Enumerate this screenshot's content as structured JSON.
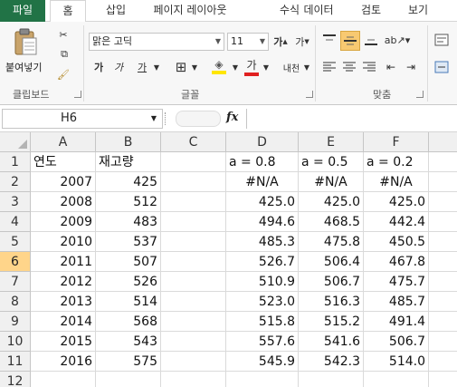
{
  "menu": {
    "tabs": [
      "파일",
      "홈",
      "삽입",
      "페이지 레이아웃",
      "수식",
      "데이터",
      "검토",
      "보기"
    ]
  },
  "ribbon": {
    "paste_label": "붙여넣기",
    "font_name": "맑은 고딕",
    "font_size": "11",
    "groups": {
      "clipboard": "클립보드",
      "font": "글꼴",
      "align": "맞춤"
    }
  },
  "formula_bar": {
    "name_box": "H6",
    "fx": "fx",
    "formula": ""
  },
  "sheet": {
    "columns": [
      "A",
      "B",
      "C",
      "D",
      "E",
      "F"
    ],
    "rows": [
      {
        "n": "1",
        "a": "연도",
        "b": "재고량",
        "c": "",
        "d": "a = 0.8",
        "e": "a = 0.5",
        "f": "a = 0.2"
      },
      {
        "n": "2",
        "a": "2007",
        "b": "425",
        "c": "",
        "d": "#N/A",
        "e": "#N/A",
        "f": "#N/A"
      },
      {
        "n": "3",
        "a": "2008",
        "b": "512",
        "c": "",
        "d": "425.0",
        "e": "425.0",
        "f": "425.0"
      },
      {
        "n": "4",
        "a": "2009",
        "b": "483",
        "c": "",
        "d": "494.6",
        "e": "468.5",
        "f": "442.4"
      },
      {
        "n": "5",
        "a": "2010",
        "b": "537",
        "c": "",
        "d": "485.3",
        "e": "475.8",
        "f": "450.5"
      },
      {
        "n": "6",
        "a": "2011",
        "b": "507",
        "c": "",
        "d": "526.7",
        "e": "506.4",
        "f": "467.8"
      },
      {
        "n": "7",
        "a": "2012",
        "b": "526",
        "c": "",
        "d": "510.9",
        "e": "506.7",
        "f": "475.7"
      },
      {
        "n": "8",
        "a": "2013",
        "b": "514",
        "c": "",
        "d": "523.0",
        "e": "516.3",
        "f": "485.7"
      },
      {
        "n": "9",
        "a": "2014",
        "b": "568",
        "c": "",
        "d": "515.8",
        "e": "515.2",
        "f": "491.4"
      },
      {
        "n": "10",
        "a": "2015",
        "b": "543",
        "c": "",
        "d": "557.6",
        "e": "541.6",
        "f": "506.7"
      },
      {
        "n": "11",
        "a": "2016",
        "b": "575",
        "c": "",
        "d": "545.9",
        "e": "542.3",
        "f": "514.0"
      },
      {
        "n": "12",
        "a": "",
        "b": "",
        "c": "",
        "d": "",
        "e": "",
        "f": ""
      }
    ],
    "selected_row": "6"
  },
  "colors": {
    "file_tab": "#217346",
    "selected_row_header": "#ffd58a"
  }
}
